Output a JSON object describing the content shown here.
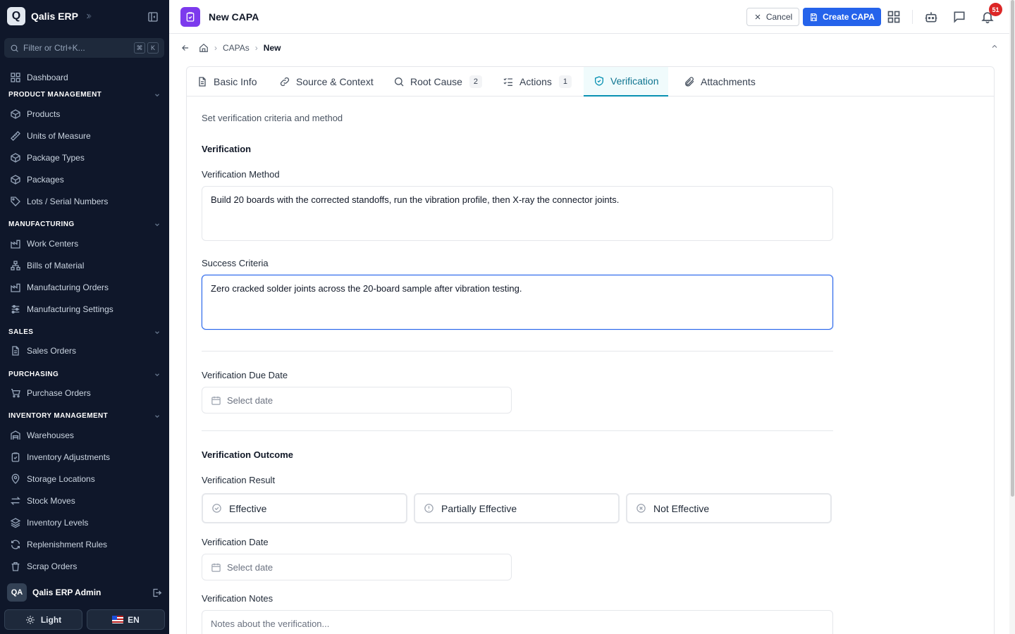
{
  "brand": {
    "logo_letter": "Q",
    "name": "Qalis ERP"
  },
  "sidebar": {
    "filter_placeholder": "Filter or Ctrl+K...",
    "filter_keys": [
      "⌘",
      "K"
    ],
    "dashboard": "Dashboard",
    "sections": [
      {
        "title": "PRODUCT MANAGEMENT",
        "items": [
          "Products",
          "Units of Measure",
          "Package Types",
          "Packages",
          "Lots / Serial Numbers"
        ]
      },
      {
        "title": "MANUFACTURING",
        "items": [
          "Work Centers",
          "Bills of Material",
          "Manufacturing Orders",
          "Manufacturing Settings"
        ]
      },
      {
        "title": "SALES",
        "items": [
          "Sales Orders"
        ]
      },
      {
        "title": "PURCHASING",
        "items": [
          "Purchase Orders"
        ]
      },
      {
        "title": "INVENTORY MANAGEMENT",
        "items": [
          "Warehouses",
          "Inventory Adjustments",
          "Storage Locations",
          "Stock Moves",
          "Inventory Levels",
          "Replenishment Rules",
          "Scrap Orders"
        ]
      }
    ],
    "user": {
      "initials": "QA",
      "name": "Qalis ERP Admin"
    },
    "theme_label": "Light",
    "language_label": "EN"
  },
  "header": {
    "title": "New CAPA",
    "cancel_label": "Cancel",
    "create_label": "Create CAPA",
    "notification_count": "51"
  },
  "breadcrumb": {
    "items": [
      "CAPAs",
      "New"
    ]
  },
  "tabs": [
    {
      "label": "Basic Info",
      "icon": "document-icon"
    },
    {
      "label": "Source & Context",
      "icon": "link-icon"
    },
    {
      "label": "Root Cause",
      "icon": "search-icon",
      "count": "2"
    },
    {
      "label": "Actions",
      "icon": "checklist-icon",
      "count": "1"
    },
    {
      "label": "Verification",
      "icon": "shield-check-icon",
      "active": true
    },
    {
      "label": "Attachments",
      "icon": "paperclip-icon"
    }
  ],
  "form": {
    "intro": "Set verification criteria and method",
    "section_title": "Verification",
    "method_label": "Verification Method",
    "method_value": "Build 20 boards with the corrected standoffs, run the vibration profile, then X-ray the connector joints.",
    "criteria_label": "Success Criteria",
    "criteria_value": "Zero cracked solder joints across the 20-board sample after vibration testing.",
    "due_date_label": "Verification Due Date",
    "date_placeholder": "Select date",
    "outcome_title": "Verification Outcome",
    "result_label": "Verification Result",
    "results": [
      "Effective",
      "Partially Effective",
      "Not Effective"
    ],
    "verification_date_label": "Verification Date",
    "notes_label": "Verification Notes",
    "notes_placeholder": "Notes about the verification..."
  },
  "colors": {
    "sidebar_bg": "#0f172a",
    "primary": "#2563eb",
    "active_tab": "#0891b2",
    "page_icon": "#7c3aed",
    "badge": "#dc2626"
  }
}
